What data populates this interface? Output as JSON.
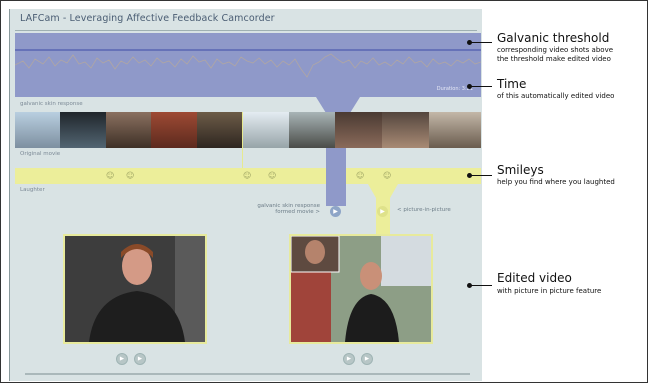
{
  "app": {
    "title": "LAFCam - Leveraging Affective Feedback Camcorder",
    "duration_label": "Duration: 3:21",
    "gsr_label": "galvanic skin response",
    "original_movie_label": "Original movie",
    "laughter_label": "Laughter",
    "gsr_formed_movie_label_line1": "galvanic skin response",
    "gsr_formed_movie_label_line2": "formed movie >",
    "pip_label": "< picture-in-picture",
    "play_glyph": "▶",
    "smiley_glyph": "☺"
  },
  "annotations": [
    {
      "title": "Galvanic threshold",
      "sub1": "corresponding video shots above",
      "sub2": "the threshold make edited video"
    },
    {
      "title": "Time",
      "sub1": "of this automatically edited video",
      "sub2": ""
    },
    {
      "title": "Smileys",
      "sub1": "help you find where you laughted",
      "sub2": ""
    },
    {
      "title": "Edited video",
      "sub1": "with picture in picture feature",
      "sub2": ""
    }
  ],
  "colors": {
    "gsr_fill": "#8f99c9",
    "laughter_fill": "#ecee9a",
    "background": "#d9e3e4"
  },
  "icons": [
    "smiley-icon",
    "play-icon"
  ]
}
